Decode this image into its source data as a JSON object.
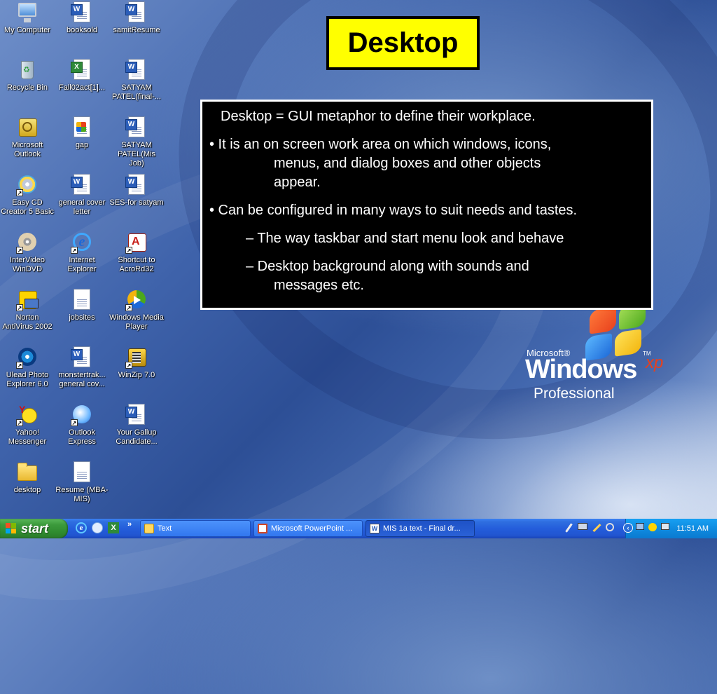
{
  "desktop": {
    "icons": [
      {
        "label": "My Computer",
        "icon": "my-computer-icon"
      },
      {
        "label": "booksold",
        "icon": "word-doc-icon"
      },
      {
        "label": "samitResume",
        "icon": "word-doc-icon"
      },
      {
        "label": "Recycle Bin",
        "icon": "recycle-bin-icon"
      },
      {
        "label": "Fall02act[1]...",
        "icon": "excel-doc-icon"
      },
      {
        "label": "SATYAM PATEL(final-...",
        "icon": "word-doc-icon"
      },
      {
        "label": "Microsoft Outlook",
        "icon": "outlook-icon"
      },
      {
        "label": "gap",
        "icon": "image-doc-icon"
      },
      {
        "label": "SATYAM PATEL(Mis Job)",
        "icon": "word-doc-icon"
      },
      {
        "label": "Easy CD Creator 5 Basic",
        "icon": "cd-creator-icon"
      },
      {
        "label": "general cover letter",
        "icon": "word-doc-icon"
      },
      {
        "label": "SES-for satyam",
        "icon": "word-doc-icon"
      },
      {
        "label": "InterVideo WinDVD",
        "icon": "windvd-icon"
      },
      {
        "label": "Internet Explorer",
        "icon": "internet-explorer-icon"
      },
      {
        "label": "Shortcut to AcroRd32",
        "icon": "acrobat-icon"
      },
      {
        "label": "Norton AntiVirus 2002",
        "icon": "norton-antivirus-icon"
      },
      {
        "label": "jobsites",
        "icon": "text-doc-icon"
      },
      {
        "label": "Windows Media Player",
        "icon": "media-player-icon"
      },
      {
        "label": "Ulead Photo Explorer 6.0",
        "icon": "photo-explorer-icon"
      },
      {
        "label": "monstertrak... general cov...",
        "icon": "word-doc-icon"
      },
      {
        "label": "WinZip 7.0",
        "icon": "winzip-icon"
      },
      {
        "label": "Yahoo! Messenger",
        "icon": "yahoo-messenger-icon"
      },
      {
        "label": "Outlook Express",
        "icon": "outlook-express-icon"
      },
      {
        "label": "Your Gallup Candidate...",
        "icon": "word-doc-icon"
      },
      {
        "label": "desktop",
        "icon": "folder-icon"
      },
      {
        "label": "Resume (MBA-MIS)",
        "icon": "text-doc-icon"
      }
    ]
  },
  "slide": {
    "title": "Desktop",
    "line1": "Desktop = GUI metaphor to define their workplace.",
    "bullet1_a": "• It is an on screen work area on which windows, icons,",
    "bullet1_b": "menus, and dialog boxes and other objects",
    "bullet1_c": "appear.",
    "bullet2": "• Can be configured in many ways to suit needs and tastes.",
    "sub1": "– The way taskbar and start menu look and behave",
    "sub2_a": "– Desktop background along with sounds and",
    "sub2_b": "messages etc."
  },
  "logo": {
    "microsoft": "Microsoft®",
    "windows": "Windows",
    "xp": "xp",
    "tm": "TM",
    "edition": "Professional"
  },
  "taskbar": {
    "start_label": "start",
    "more_label": "»",
    "buttons": [
      {
        "label": "Text",
        "icon": "folder-icon",
        "active": false
      },
      {
        "label": "Microsoft PowerPoint ...",
        "icon": "powerpoint-icon",
        "active": false
      },
      {
        "label": "MIS 1a text - Final dr...",
        "icon": "word-icon",
        "active": true
      }
    ],
    "clock": "11:51 AM"
  }
}
